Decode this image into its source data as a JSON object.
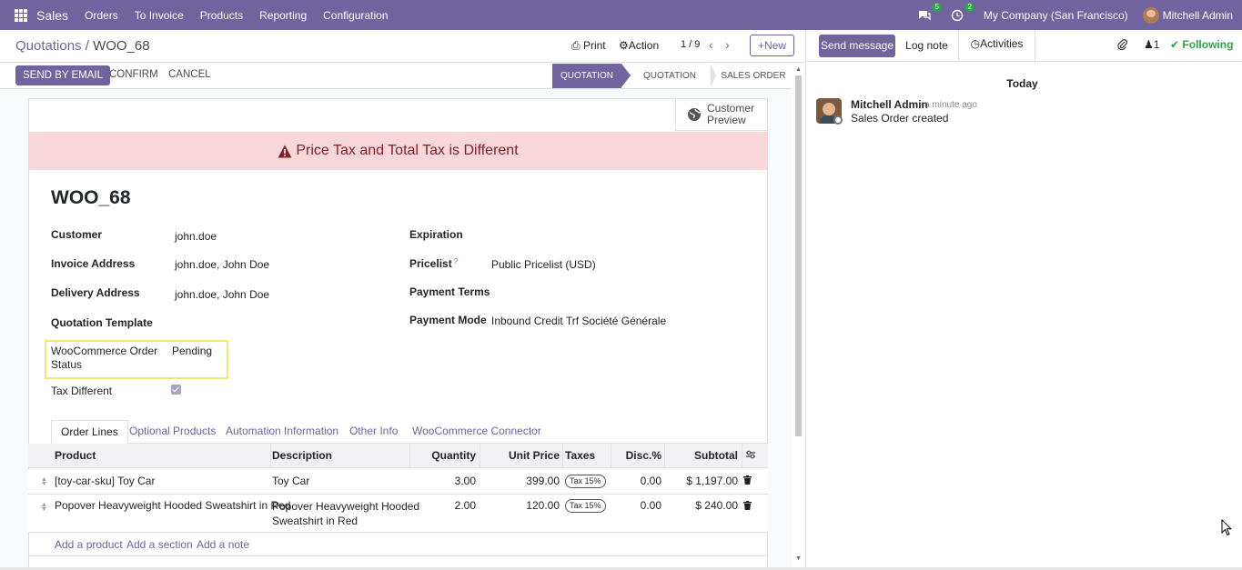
{
  "navbar": {
    "app_name": "Sales",
    "menu": [
      "Orders",
      "To Invoice",
      "Products",
      "Reporting",
      "Configuration"
    ],
    "messages_count": "5",
    "activities_count": "2",
    "company": "My Company (San Francisco)",
    "user": "Mitchell Admin"
  },
  "control_panel": {
    "breadcrumb_parent": "Quotations",
    "breadcrumb_sep": " / ",
    "breadcrumb_current": "WOO_68",
    "print_label": "Print",
    "action_label": "Action",
    "pager": "1 / 9",
    "new_label": "New"
  },
  "status_bar": {
    "send_by_email": "SEND BY EMAIL",
    "confirm": "CONFIRM",
    "cancel": "CANCEL",
    "stages": [
      "QUOTATION",
      "QUOTATION SENT",
      "SALES ORDER"
    ],
    "active_stage": "QUOTATION"
  },
  "form": {
    "customer_preview": "Customer Preview",
    "alert": "Price Tax and Total Tax is Different",
    "name": "WOO_68",
    "left_fields": [
      {
        "label": "Customer",
        "value": "john.doe"
      },
      {
        "label": "Invoice Address",
        "value": "john.doe, John Doe"
      },
      {
        "label": "Delivery Address",
        "value": "john.doe, John Doe"
      },
      {
        "label": "Quotation Template",
        "value": ""
      }
    ],
    "woo_status_label": "WooCommerce Order Status",
    "woo_status_value": "Pending",
    "tax_different_label": "Tax Different",
    "tax_different_checked": true,
    "right_fields": [
      {
        "label": "Expiration",
        "value": ""
      },
      {
        "label": "Pricelist",
        "value": "Public Pricelist (USD)",
        "help": "?"
      },
      {
        "label": "Payment Terms",
        "value": ""
      },
      {
        "label": "Payment Mode",
        "value": "Inbound Credit Trf Société Générale"
      }
    ]
  },
  "tabs": [
    "Order Lines",
    "Optional Products",
    "Automation Information",
    "Other Info",
    "WooCommerce Connector"
  ],
  "active_tab": "Order Lines",
  "order_lines": {
    "columns": [
      "Product",
      "Description",
      "Quantity",
      "Unit Price",
      "Taxes",
      "Disc.%",
      "Subtotal"
    ],
    "rows": [
      {
        "product": "[toy-car-sku] Toy Car",
        "description": "Toy Car",
        "quantity": "3.00",
        "unit_price": "399.00",
        "tax": "Tax 15%",
        "discount": "0.00",
        "subtotal": "$ 1,197.00"
      },
      {
        "product": "Popover Heavyweight Hooded Sweatshirt in Red",
        "description_line1": "Popover Heavyweight Hooded",
        "description_line2": "Sweatshirt in Red",
        "quantity": "2.00",
        "unit_price": "120.00",
        "tax": "Tax 15%",
        "discount": "0.00",
        "subtotal": "$ 240.00"
      }
    ],
    "add_product": "Add a product",
    "add_section": "Add a section",
    "add_note": "Add a note"
  },
  "chatter": {
    "send_message": "Send message",
    "log_note": "Log note",
    "activities": "Activities",
    "followers_count": "1",
    "following": "Following",
    "date_separator": "Today",
    "messages": [
      {
        "author": "Mitchell Admin",
        "time": "- a minute ago",
        "body": "Sales Order created"
      }
    ]
  },
  "colors": {
    "brand": "#71639e",
    "alert_bg": "#f8d7da",
    "alert_text": "#842029",
    "following": "#28a745"
  }
}
